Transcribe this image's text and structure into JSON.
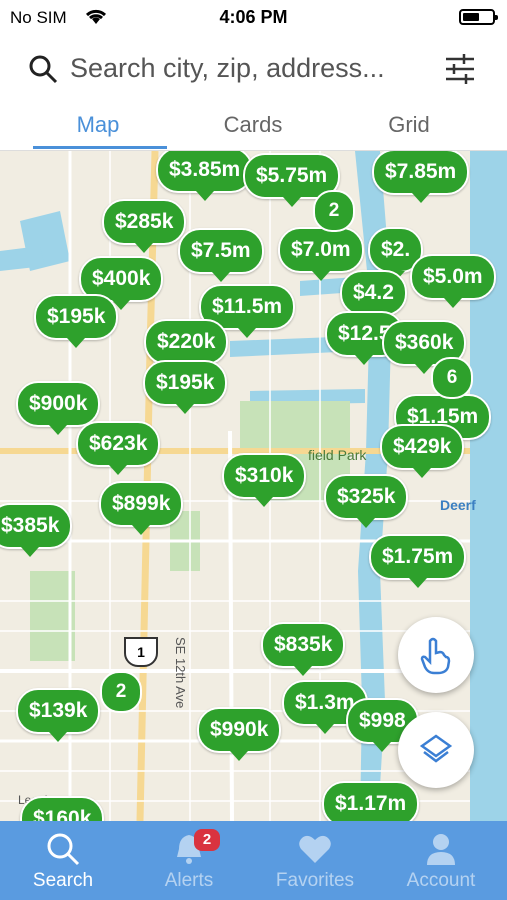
{
  "status": {
    "carrier": "No SIM",
    "time": "4:06 PM"
  },
  "search": {
    "placeholder": "Search city, zip, address..."
  },
  "tabs": [
    {
      "label": "Map"
    },
    {
      "label": "Cards"
    },
    {
      "label": "Grid"
    }
  ],
  "map": {
    "pins": [
      {
        "price": "$3.85m"
      },
      {
        "price": "$5.75m"
      },
      {
        "price": "$7.85m"
      },
      {
        "price": "$285k"
      },
      {
        "price": "$7.5m"
      },
      {
        "price": "$7.0m"
      },
      {
        "price": "$5.0m"
      },
      {
        "price": "$400k"
      },
      {
        "price": "$11.5m"
      },
      {
        "price": "$195k"
      },
      {
        "price": "$220k"
      },
      {
        "price": "$360k"
      },
      {
        "price": "$195k"
      },
      {
        "price": "$900k"
      },
      {
        "price": "$623k"
      },
      {
        "price": "$429k"
      },
      {
        "price": "$310k"
      },
      {
        "price": "$325k"
      },
      {
        "price": "$899k"
      },
      {
        "price": "$385k"
      },
      {
        "price": "$1.75m"
      },
      {
        "price": "$835k"
      },
      {
        "price": "$1.3m"
      },
      {
        "price": "$139k"
      },
      {
        "price": "$990k"
      },
      {
        "price": "$1.17m"
      },
      {
        "price": "$160k"
      },
      {
        "price": "$2."
      },
      {
        "price": "$4.2"
      },
      {
        "price": "$12.5"
      },
      {
        "price": "$1.15m"
      },
      {
        "price": "$998"
      }
    ],
    "clusters": [
      {
        "count": "2"
      },
      {
        "count": "6"
      },
      {
        "count": "2"
      }
    ],
    "labels": {
      "park": "field Park",
      "road": "SE 12th Ave",
      "shield": "1",
      "beach": "Deerf",
      "legal": "Legal"
    }
  },
  "tabbar": {
    "items": [
      {
        "label": "Search",
        "icon": "search-icon"
      },
      {
        "label": "Alerts",
        "icon": "bell-icon",
        "badge": "2"
      },
      {
        "label": "Favorites",
        "icon": "heart-icon"
      },
      {
        "label": "Account",
        "icon": "person-icon"
      }
    ]
  },
  "colors": {
    "accent": "#4a90d9",
    "pin": "#2ea12c",
    "tabbar": "#5a9be0",
    "water": "#9dd3e8"
  }
}
